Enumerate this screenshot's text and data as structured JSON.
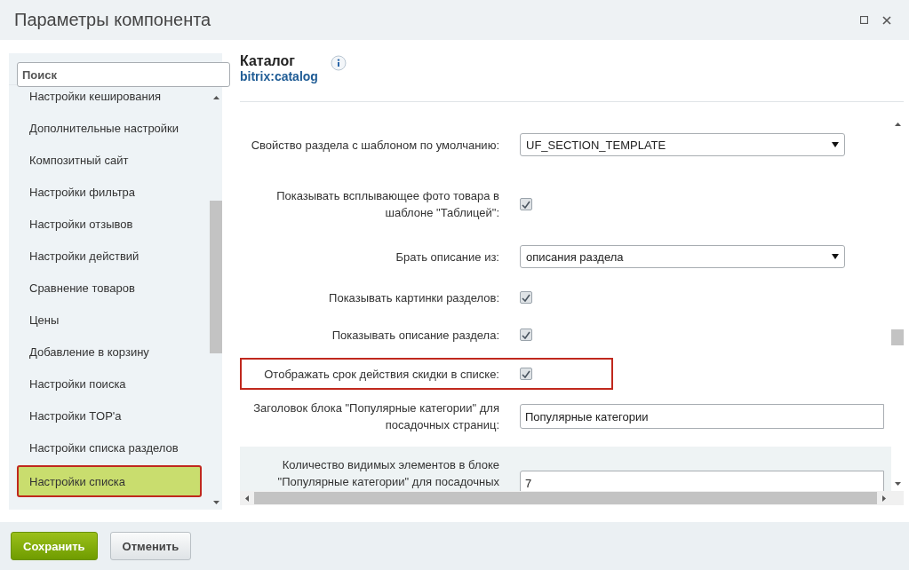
{
  "window": {
    "title": "Параметры компонента"
  },
  "sidebar": {
    "search": {
      "placeholder": "Поиск"
    },
    "items": [
      {
        "label": "Настройки кеширования",
        "selected": false
      },
      {
        "label": "Дополнительные настройки",
        "selected": false
      },
      {
        "label": "Композитный сайт",
        "selected": false
      },
      {
        "label": "Настройки фильтра",
        "selected": false
      },
      {
        "label": "Настройки отзывов",
        "selected": false
      },
      {
        "label": "Настройки действий",
        "selected": false
      },
      {
        "label": "Сравнение товаров",
        "selected": false
      },
      {
        "label": "Цены",
        "selected": false
      },
      {
        "label": "Добавление в корзину",
        "selected": false
      },
      {
        "label": "Настройки поиска",
        "selected": false
      },
      {
        "label": "Настройки TOP'a",
        "selected": false
      },
      {
        "label": "Настройки списка разделов",
        "selected": false
      },
      {
        "label": "Настройки списка",
        "selected": true
      }
    ]
  },
  "component": {
    "title": "Каталог",
    "code": "bitrix:catalog"
  },
  "fields": [
    {
      "kind": "select",
      "label": "Свойство раздела с шаблоном по умолчанию:",
      "value": "UF_SECTION_TEMPLATE",
      "highlighted": false,
      "hovered": false
    },
    {
      "kind": "checkbox",
      "label": "Показывать всплывающее фото товара в шаблоне \"Таблицей\":",
      "checked": true,
      "highlighted": false,
      "hovered": false
    },
    {
      "kind": "select",
      "label": "Брать описание из:",
      "value": "описания раздела",
      "highlighted": false,
      "hovered": false
    },
    {
      "kind": "checkbox",
      "label": "Показывать картинки разделов:",
      "checked": true,
      "highlighted": false,
      "hovered": false
    },
    {
      "kind": "checkbox",
      "label": "Показывать описание раздела:",
      "checked": true,
      "highlighted": false,
      "hovered": false
    },
    {
      "kind": "checkbox",
      "label": "Отображать срок действия скидки в списке:",
      "checked": true,
      "highlighted": true,
      "hovered": false
    },
    {
      "kind": "text",
      "label": "Заголовок блока \"Популярные категории\" для посадочных страниц:",
      "value": "Популярные категории",
      "highlighted": false,
      "hovered": false
    },
    {
      "kind": "text",
      "label": "Количество видимых элементов в блоке \"Популярные категории\" для посадочных",
      "value": "7",
      "highlighted": false,
      "hovered": true
    }
  ],
  "buttons": [
    {
      "label": "Сохранить",
      "kind": "primary"
    },
    {
      "label": "Отменить",
      "kind": "secondary"
    }
  ]
}
